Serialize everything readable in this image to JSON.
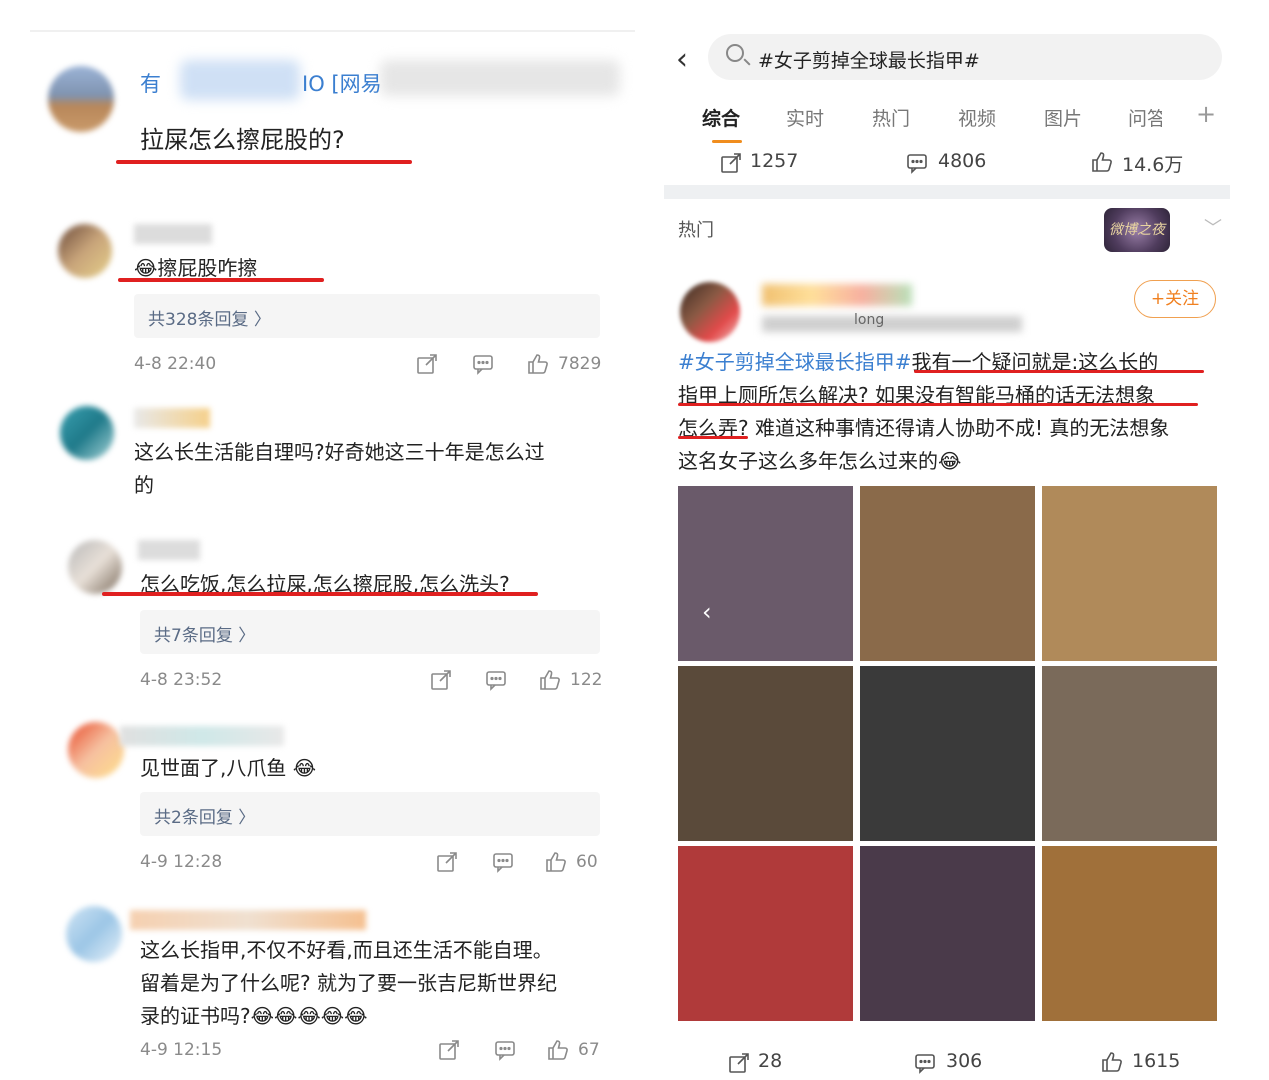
{
  "left": {
    "post": {
      "name_visible_start": "有",
      "name_visible_end": "IO [网易",
      "text": "拉屎怎么擦屁股的?"
    },
    "comments": [
      {
        "text": "擦屁股咋擦",
        "emoji": "😂",
        "replies": "共328条回复 〉",
        "time": "4-8 22:40",
        "likes": "7829"
      },
      {
        "text_line1": "这么长生活能自理吗?好奇她这三十年是怎么过",
        "text_line2": "的"
      },
      {
        "text": "怎么吃饭,怎么拉屎,怎么擦屁股,怎么洗头?",
        "replies": "共7条回复 〉",
        "time": "4-8 23:52",
        "likes": "122"
      },
      {
        "text": "见世面了,八爪鱼 😂",
        "replies": "共2条回复 〉",
        "time": "4-9 12:28",
        "likes": "60"
      },
      {
        "text_line1": "这么长指甲,不仅不好看,而且还生活不能自理。",
        "text_line2": "留着是为了什么呢? 就为了要一张吉尼斯世界纪",
        "text_line3": "录的证书吗?😂😂😂😂😂",
        "time": "4-9 12:15",
        "likes": "67"
      }
    ]
  },
  "right": {
    "search_query": "#女子剪掉全球最长指甲#",
    "tabs": [
      "综合",
      "实时",
      "热门",
      "视频",
      "图片",
      "问答"
    ],
    "active_tab": "综合",
    "stats": {
      "reposts": "1257",
      "comments": "4806",
      "likes": "14.6万"
    },
    "hot_label": "热门",
    "badge_text": "微博之夜",
    "follow_label": "+关注",
    "user_partial": "long",
    "post": {
      "hashtag": "#女子剪掉全球最长指甲#",
      "line1_rest": "我有一个疑问就是:这么长的",
      "line2": "指甲上厕所怎么解决? 如果没有智能马桶的话无法想象",
      "line3": "怎么弄? 难道这种事情还得请人协助不成! 真的无法想象",
      "line4": "这名女子这么多年怎么过来的😂"
    },
    "bottom": {
      "reposts": "28",
      "comments": "306",
      "likes": "1615"
    }
  },
  "colors": {
    "link": "#3b7fd0",
    "accent": "#f08d1e",
    "underline": "#e02020"
  }
}
